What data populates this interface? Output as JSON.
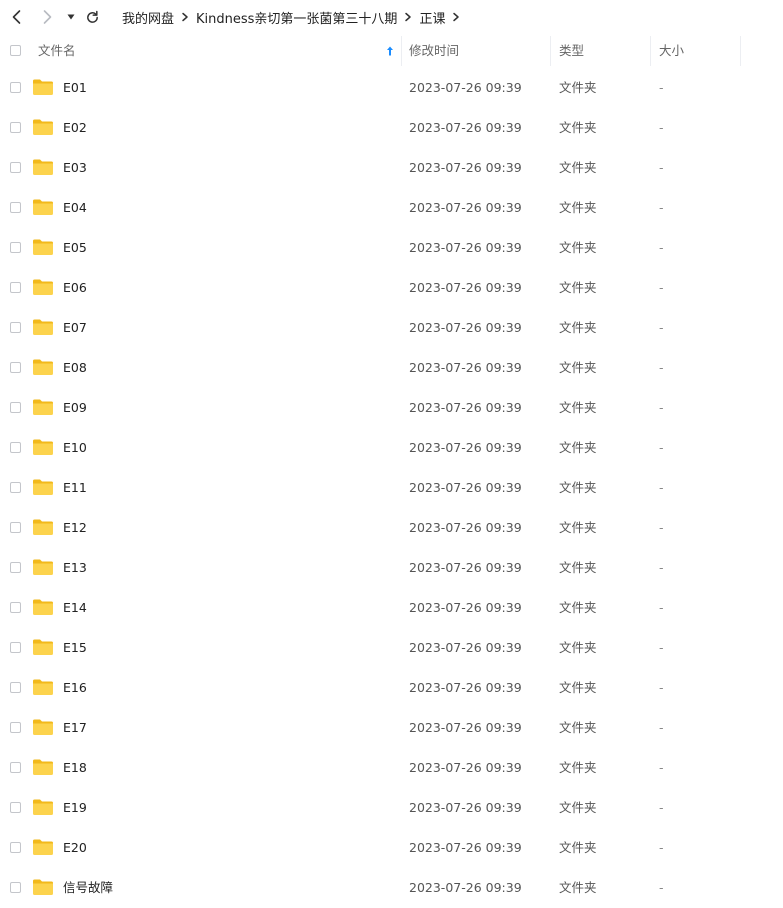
{
  "breadcrumb": [
    "我的网盘",
    "Kindness亲切第一张菌第三十八期",
    "正课"
  ],
  "columns": {
    "name": "文件名",
    "modified": "修改时间",
    "type": "类型",
    "size": "大小"
  },
  "colors": {
    "folder": "#f7c325",
    "folder_light": "#fdd85a",
    "sort_arrow": "#1a8cff"
  },
  "rows": [
    {
      "name": "E01",
      "modified": "2023-07-26 09:39",
      "type": "文件夹",
      "size": "-"
    },
    {
      "name": "E02",
      "modified": "2023-07-26 09:39",
      "type": "文件夹",
      "size": "-"
    },
    {
      "name": "E03",
      "modified": "2023-07-26 09:39",
      "type": "文件夹",
      "size": "-"
    },
    {
      "name": "E04",
      "modified": "2023-07-26 09:39",
      "type": "文件夹",
      "size": "-"
    },
    {
      "name": "E05",
      "modified": "2023-07-26 09:39",
      "type": "文件夹",
      "size": "-"
    },
    {
      "name": "E06",
      "modified": "2023-07-26 09:39",
      "type": "文件夹",
      "size": "-"
    },
    {
      "name": "E07",
      "modified": "2023-07-26 09:39",
      "type": "文件夹",
      "size": "-"
    },
    {
      "name": "E08",
      "modified": "2023-07-26 09:39",
      "type": "文件夹",
      "size": "-"
    },
    {
      "name": "E09",
      "modified": "2023-07-26 09:39",
      "type": "文件夹",
      "size": "-"
    },
    {
      "name": "E10",
      "modified": "2023-07-26 09:39",
      "type": "文件夹",
      "size": "-"
    },
    {
      "name": "E11",
      "modified": "2023-07-26 09:39",
      "type": "文件夹",
      "size": "-"
    },
    {
      "name": "E12",
      "modified": "2023-07-26 09:39",
      "type": "文件夹",
      "size": "-"
    },
    {
      "name": "E13",
      "modified": "2023-07-26 09:39",
      "type": "文件夹",
      "size": "-"
    },
    {
      "name": "E14",
      "modified": "2023-07-26 09:39",
      "type": "文件夹",
      "size": "-"
    },
    {
      "name": "E15",
      "modified": "2023-07-26 09:39",
      "type": "文件夹",
      "size": "-"
    },
    {
      "name": "E16",
      "modified": "2023-07-26 09:39",
      "type": "文件夹",
      "size": "-"
    },
    {
      "name": "E17",
      "modified": "2023-07-26 09:39",
      "type": "文件夹",
      "size": "-"
    },
    {
      "name": "E18",
      "modified": "2023-07-26 09:39",
      "type": "文件夹",
      "size": "-"
    },
    {
      "name": "E19",
      "modified": "2023-07-26 09:39",
      "type": "文件夹",
      "size": "-"
    },
    {
      "name": "E20",
      "modified": "2023-07-26 09:39",
      "type": "文件夹",
      "size": "-"
    },
    {
      "name": "信号故障",
      "modified": "2023-07-26 09:39",
      "type": "文件夹",
      "size": "-"
    }
  ]
}
